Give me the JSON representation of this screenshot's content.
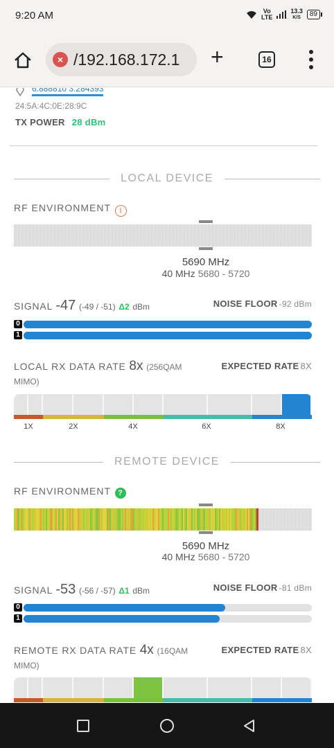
{
  "status": {
    "time": "9:20 AM",
    "net_top": "Vo",
    "net_bottom": "LTE",
    "speed_top": "13.3",
    "speed_bottom": "K/S",
    "battery": "89"
  },
  "browser": {
    "url": "/192.168.172.1",
    "tab_count": "16"
  },
  "device": {
    "coords": "6.888810 3.284393",
    "mac": "24:5A:4C:0E:28:9C",
    "tx_power_label": "TX POWER",
    "tx_power_value": "28 dBm"
  },
  "local": {
    "heading": "LOCAL DEVICE",
    "rf_label": "RF ENVIRONMENT",
    "freq": "5690 MHz",
    "width": "40 MHz",
    "range": "5680 - 5720",
    "signal_label": "SIGNAL",
    "signal_value": "-47",
    "signal_chains": "(-49 / -51)",
    "signal_delta": "Δ2",
    "signal_unit": "dBm",
    "noise_label": "NOISE FLOOR",
    "noise_value": "-92 dBm",
    "chain0_pct": 100,
    "chain1_pct": 100,
    "rate_label": "LOCAL RX DATA RATE",
    "rate_value": "8x",
    "rate_detail": "(256QAM MIMO)",
    "expected_label": "EXPECTED RATE",
    "expected_value": "8X",
    "active_rate": "8X"
  },
  "remote": {
    "heading": "REMOTE DEVICE",
    "rf_label": "RF ENVIRONMENT",
    "freq": "5690 MHz",
    "width": "40 MHz",
    "range": "5680 - 5720",
    "signal_label": "SIGNAL",
    "signal_value": "-53",
    "signal_chains": "(-56 / -57)",
    "signal_delta": "Δ1",
    "signal_unit": "dBm",
    "noise_label": "NOISE FLOOR",
    "noise_value": "-81 dBm",
    "chain0_pct": 70,
    "chain1_pct": 68,
    "rate_label": "REMOTE RX DATA RATE",
    "rate_value": "4x",
    "rate_detail": "(16QAM MIMO)",
    "expected_label": "EXPECTED RATE",
    "expected_value": "8X",
    "active_rate": "4X"
  },
  "rate_ticks": [
    "1X",
    "2X",
    "4X",
    "6X",
    "8X"
  ],
  "colors": {
    "accent_blue": "#2384d1",
    "green": "#2ebd5a",
    "teal": "#2ebd7a",
    "orange": "#e07a4f"
  },
  "icons": [
    "home-icon",
    "close-icon",
    "plus-icon",
    "tabs-icon",
    "more-vert-icon",
    "info-icon",
    "help-icon",
    "location-pin-icon",
    "nav-recents-icon",
    "nav-home-icon",
    "nav-back-icon"
  ]
}
